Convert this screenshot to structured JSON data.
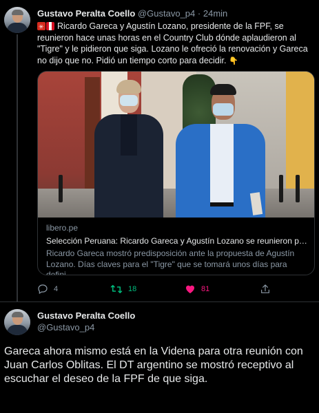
{
  "tweet1": {
    "display_name": "Gustavo Peralta Coello",
    "handle": "@Gustavo_p4",
    "separator": "·",
    "time": "24min",
    "text": "Ricardo Gareca y Agustín Lozano, presidente de la FPF, se reunieron hace unas horas en el Country Club dónde aplaudieron al \"Tigre\" y le pidieron que siga. Lozano le ofreció la renovación y Gareca no dijo que no. Pidió un tiempo corto para decidir.",
    "card": {
      "domain": "libero.pe",
      "title": "Selección Peruana: Ricardo Gareca y Agustín Lozano se reunieron para ...",
      "description": "Ricardo Gareca mostró predisposición ante la propuesta de Agustín Lozano. Días claves para el \"Tigre\" que se tomará unos días para defini..."
    },
    "actions": {
      "replies": "4",
      "retweets": "18",
      "likes": "81"
    }
  },
  "tweet2": {
    "display_name": "Gustavo Peralta Coello",
    "handle": "@Gustavo_p4",
    "text": "Gareca ahora mismo está en la Videna para otra reunión con Juan Carlos Oblitas. El DT argentino se mostró receptivo al escuchar el deseo de la FPF de que siga."
  },
  "icons": {
    "reply": "reply-icon",
    "retweet": "retweet-icon",
    "like": "heart-icon",
    "share": "share-icon",
    "flags": [
      "red-asterisk-emoji",
      "peru-flag-emoji"
    ],
    "hand": "pointing-down-emoji"
  },
  "colors": {
    "background": "#000000",
    "text": "#e7e9ea",
    "muted": "#8b98a5",
    "retweet": "#00ba7c",
    "like": "#f91880",
    "border": "#2f3336"
  }
}
